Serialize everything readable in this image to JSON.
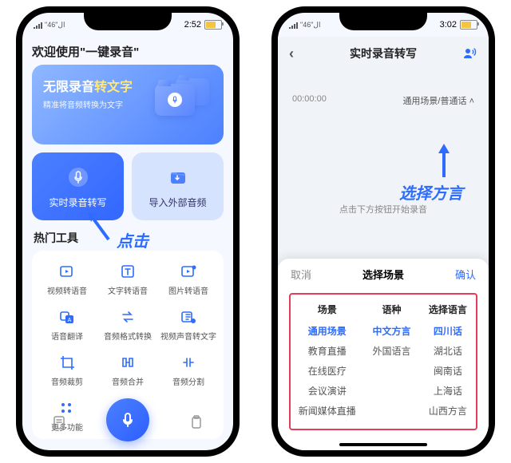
{
  "phone1": {
    "status": {
      "time": "2:52"
    },
    "welcome": "欢迎使用\"一键录音\"",
    "hero": {
      "title_a": "无限录音",
      "title_b": "转文字",
      "sub": "精准将音频转换为文字"
    },
    "twin": [
      {
        "label": "实时录音转写",
        "main": true
      },
      {
        "label": "导入外部音频",
        "main": false
      }
    ],
    "section": "热门工具",
    "tools": [
      {
        "label": "视频转语音",
        "icon": "video"
      },
      {
        "label": "文字转语音",
        "icon": "text"
      },
      {
        "label": "图片转语音",
        "icon": "image"
      },
      {
        "label": "语音翻译",
        "icon": "translate"
      },
      {
        "label": "音频格式转换",
        "icon": "convert"
      },
      {
        "label": "视频声音转文字",
        "icon": "extract"
      },
      {
        "label": "音频裁剪",
        "icon": "crop"
      },
      {
        "label": "音频合并",
        "icon": "merge"
      },
      {
        "label": "音频分割",
        "icon": "split"
      },
      {
        "label": "更多功能",
        "icon": "more"
      }
    ],
    "annotation": "点击"
  },
  "phone2": {
    "status": {
      "time": "3:02"
    },
    "topbar": {
      "title": "实时录音转写"
    },
    "rec": {
      "timer": "00:00:00",
      "mode": "通用场景/普通话"
    },
    "hint": "点击下方按钮开始录音",
    "annotation": "选择方言",
    "sheet": {
      "cancel": "取消",
      "title": "选择场景",
      "confirm": "确认",
      "headers": [
        "场景",
        "语种",
        "选择语言"
      ],
      "rows": [
        {
          "c1": "通用场景",
          "c2": "中文方言",
          "c3": "四川话",
          "active": true
        },
        {
          "c1": "教育直播",
          "c2": "外国语言",
          "c3": "湖北话",
          "active": false
        },
        {
          "c1": "在线医疗",
          "c2": "",
          "c3": "闽南话",
          "active": false
        },
        {
          "c1": "会议演讲",
          "c2": "",
          "c3": "上海话",
          "active": false
        },
        {
          "c1": "新闻媒体直播",
          "c2": "",
          "c3": "山西方言",
          "active": false
        }
      ]
    }
  }
}
